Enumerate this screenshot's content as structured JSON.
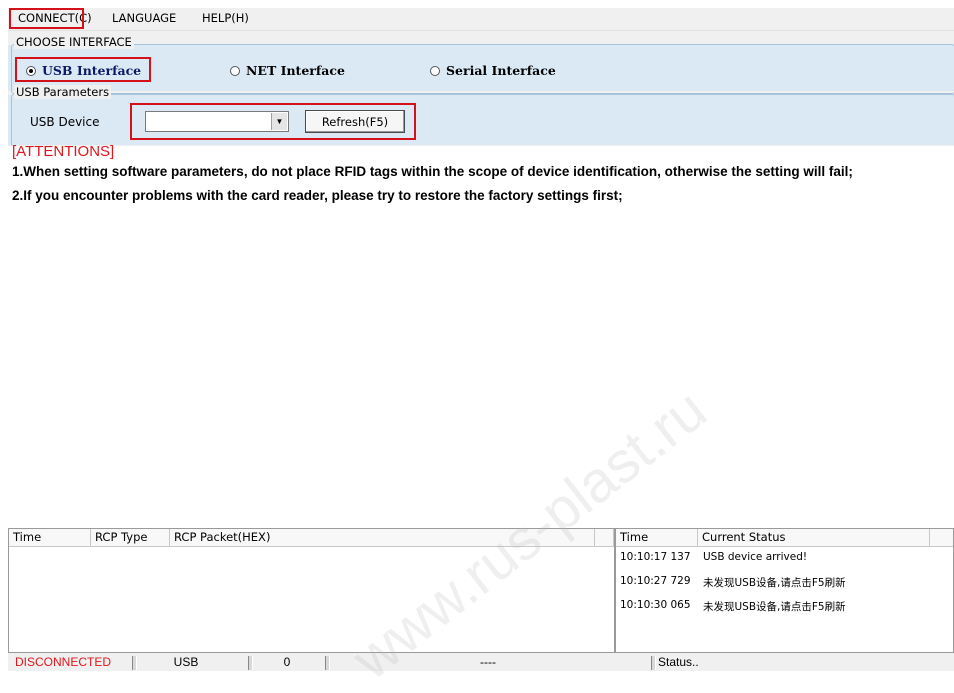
{
  "menu": {
    "items": [
      {
        "label": "CONNECT(C)"
      },
      {
        "label": "LANGUAGE"
      },
      {
        "label": "HELP(H)"
      }
    ]
  },
  "interface_group": {
    "title": "CHOOSE INTERFACE",
    "options": [
      {
        "label": "USB Interface",
        "selected": true
      },
      {
        "label": "NET Interface",
        "selected": false
      },
      {
        "label": "Serial Interface",
        "selected": false
      }
    ]
  },
  "usb_group": {
    "title": "USB Parameters",
    "device_label": "USB Device",
    "device_value": "",
    "refresh_label": "Refresh(F5)"
  },
  "attentions": {
    "title": "[ATTENTIONS]",
    "lines": [
      "1.When setting software parameters, do not place RFID tags within the scope of device identification, otherwise the setting will fail;",
      "2.If you encounter problems with the card reader, please try to restore the factory settings first;"
    ]
  },
  "packet_table": {
    "columns": [
      "Time",
      "RCP Type",
      "RCP Packet(HEX)"
    ],
    "rows": []
  },
  "status_table": {
    "columns": [
      "Time",
      "Current Status"
    ],
    "rows": [
      {
        "time": "10:10:17 137",
        "status": "USB device arrived!"
      },
      {
        "time": "10:10:27 729",
        "status": "未发现USB设备,请点击F5刷新"
      },
      {
        "time": "10:10:30 065",
        "status": "未发现USB设备,请点击F5刷新"
      }
    ]
  },
  "statusbar": {
    "connection": "DISCONNECTED",
    "interface": "USB",
    "count": "0",
    "info": "----",
    "status": "Status.."
  },
  "watermark": "www.rus-plast.ru",
  "colors": {
    "highlight_red": "#d4111b",
    "attention_red": "#e0161d",
    "panel_blue": "#dbe9f5",
    "disconnected_red": "#e0161d"
  }
}
